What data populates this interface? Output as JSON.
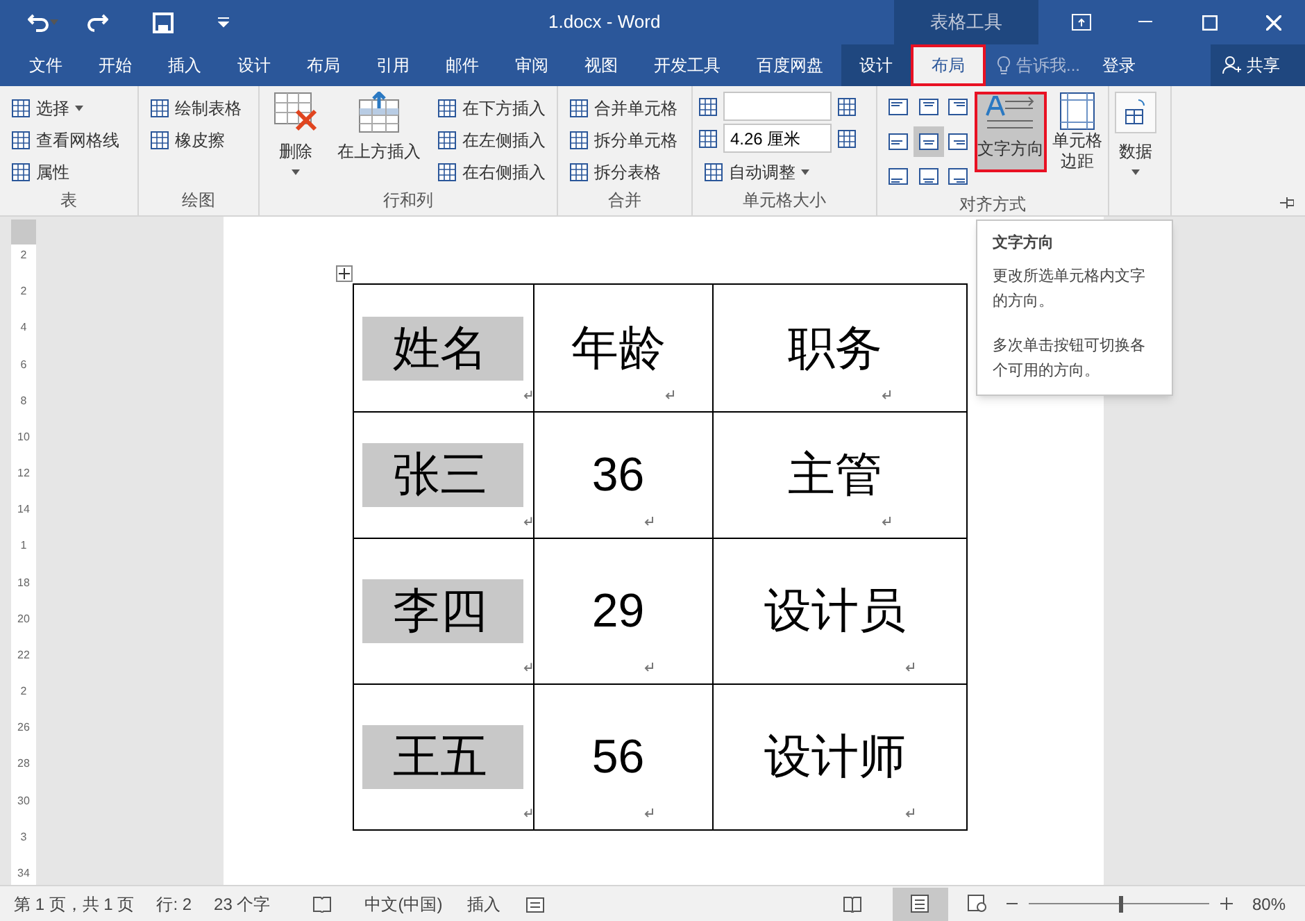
{
  "title_bar": {
    "title": "1.docx - Word",
    "context_group": "表格工具"
  },
  "tabs": [
    {
      "label": "文件",
      "selected": false,
      "context": false
    },
    {
      "label": "开始",
      "selected": false,
      "context": false
    },
    {
      "label": "插入",
      "selected": false,
      "context": false
    },
    {
      "label": "设计",
      "selected": false,
      "context": false
    },
    {
      "label": "布局",
      "selected": false,
      "context": false
    },
    {
      "label": "引用",
      "selected": false,
      "context": false
    },
    {
      "label": "邮件",
      "selected": false,
      "context": false
    },
    {
      "label": "审阅",
      "selected": false,
      "context": false
    },
    {
      "label": "视图",
      "selected": false,
      "context": false
    },
    {
      "label": "开发工具",
      "selected": false,
      "context": false
    },
    {
      "label": "百度网盘",
      "selected": false,
      "context": false
    },
    {
      "label": "设计",
      "selected": false,
      "context": true
    },
    {
      "label": "布局",
      "selected": true,
      "context": true
    }
  ],
  "tell_me": "告诉我...",
  "sign_in": "登录",
  "share": "共享",
  "ribbon": {
    "table_group": {
      "label": "表",
      "items": [
        {
          "label": "选择",
          "dropdown": true
        },
        {
          "label": "查看网格线",
          "dropdown": false
        },
        {
          "label": "属性",
          "dropdown": false
        }
      ]
    },
    "draw_group": {
      "label": "绘图",
      "items": [
        {
          "label": "绘制表格",
          "dropdown": false
        },
        {
          "label": "橡皮擦",
          "dropdown": false
        }
      ]
    },
    "rows_group": {
      "label": "行和列",
      "delete": "删除",
      "insert_above": "在上方插入",
      "items": [
        {
          "label": "在下方插入",
          "dropdown": false
        },
        {
          "label": "在左侧插入",
          "dropdown": false
        },
        {
          "label": "在右侧插入",
          "dropdown": false
        }
      ]
    },
    "merge_group": {
      "label": "合并",
      "items": [
        {
          "label": "合并单元格",
          "dropdown": false
        },
        {
          "label": "拆分单元格",
          "dropdown": false
        },
        {
          "label": "拆分表格",
          "dropdown": false
        }
      ]
    },
    "size_group": {
      "label": "单元格大小",
      "width_value": "4.26 厘米",
      "autofit": "自动调整"
    },
    "align_group": {
      "label": "对齐方式",
      "alignments": [
        {
          "selected": false
        },
        {
          "selected": false
        },
        {
          "selected": false
        },
        {
          "selected": false
        },
        {
          "selected": true
        },
        {
          "selected": false
        },
        {
          "selected": false
        },
        {
          "selected": false
        },
        {
          "selected": false
        }
      ],
      "text_direction": {
        "label": "文字方向",
        "selected": true
      },
      "margins": {
        "lines": [
          "单元格",
          "边距"
        ]
      }
    },
    "data_group": {
      "label": "数据"
    }
  },
  "tooltip": {
    "title": "文字方向",
    "paragraphs": [
      "更改所选单元格内文字的方向。",
      "多次单击按钮可切换各个可用的方向。"
    ]
  },
  "ruler": [
    "2",
    "2",
    "4",
    "6",
    "8",
    "10",
    "12",
    "14",
    "1",
    "18",
    "20",
    "22",
    "2",
    "26",
    "28",
    "30",
    "3",
    "34"
  ],
  "table": {
    "rows": [
      {
        "cells": [
          {
            "text": "姓名",
            "highlighted": true
          },
          {
            "text": "年龄",
            "highlighted": false
          },
          {
            "text": "职务",
            "highlighted": false
          }
        ]
      },
      {
        "cells": [
          {
            "text": "张三",
            "highlighted": true
          },
          {
            "text": "36",
            "highlighted": false
          },
          {
            "text": "主管",
            "highlighted": false
          }
        ]
      },
      {
        "cells": [
          {
            "text": "李四",
            "highlighted": true
          },
          {
            "text": "29",
            "highlighted": false
          },
          {
            "text": "设计员",
            "highlighted": false
          }
        ]
      },
      {
        "cells": [
          {
            "text": "王五",
            "highlighted": true
          },
          {
            "text": "56",
            "highlighted": false
          },
          {
            "text": "设计师",
            "highlighted": false
          }
        ]
      }
    ]
  },
  "status_bar": {
    "page": "第 1 页，共 1 页",
    "line": "行: 2",
    "words": "23 个字",
    "language": "中文(中国)",
    "mode": "插入",
    "zoom": "80%",
    "zoom_slider": {
      "level": 0.5
    }
  }
}
